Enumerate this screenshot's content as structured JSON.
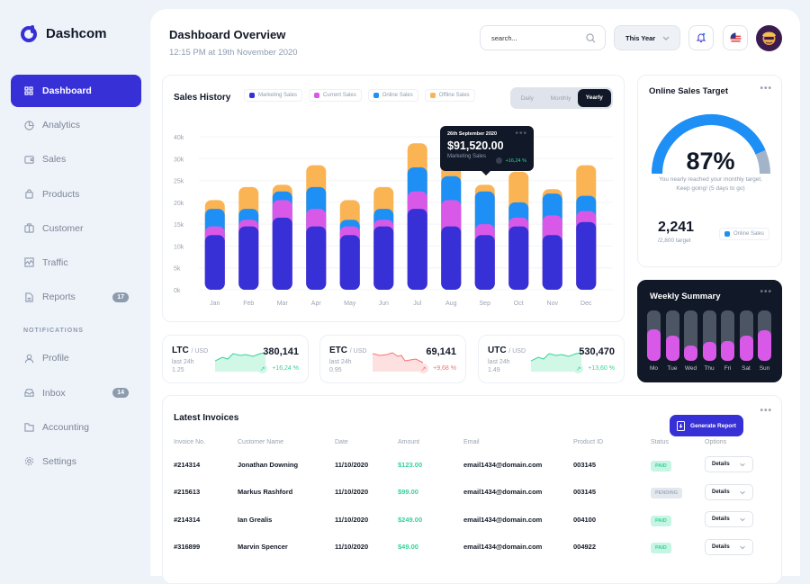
{
  "app": {
    "name": "Dashcom"
  },
  "sidebar": {
    "items": [
      {
        "label": "Dashboard",
        "icon": "grid-icon",
        "active": true
      },
      {
        "label": "Analytics",
        "icon": "pie-chart-icon"
      },
      {
        "label": "Sales",
        "icon": "wallet-icon"
      },
      {
        "label": "Products",
        "icon": "shopping-bag-icon"
      },
      {
        "label": "Customer",
        "icon": "briefcase-icon"
      },
      {
        "label": "Traffic",
        "icon": "activity-icon"
      },
      {
        "label": "Reports",
        "icon": "document-icon",
        "badge": "17"
      }
    ],
    "section_label": "NOTIFICATIONS",
    "notif_items": [
      {
        "label": "Profile",
        "icon": "user-icon"
      },
      {
        "label": "Inbox",
        "icon": "inbox-icon",
        "badge": "14"
      },
      {
        "label": "Accounting",
        "icon": "folder-icon"
      },
      {
        "label": "Settings",
        "icon": "gear-icon"
      }
    ]
  },
  "header": {
    "title": "Dashboard Overview",
    "subtitle": "12:15 PM at 19th November 2020",
    "search_placeholder": "search...",
    "period": "This Year"
  },
  "sales_history": {
    "title": "Sales History",
    "legend": [
      "Marketing Sales",
      "Current Sales",
      "Online Sales",
      "Offline Sales"
    ],
    "tabs": [
      "Daily",
      "Monthly",
      "Yearly"
    ],
    "active_tab": "Yearly",
    "tooltip": {
      "date": "26th September 2020",
      "value": "$91,520.00",
      "label": "Marketing Sales",
      "change": "+16,24 %"
    }
  },
  "chart_data": {
    "type": "bar",
    "stacked": true,
    "title": "Sales History",
    "categories": [
      "Jan",
      "Feb",
      "Mar",
      "Apr",
      "May",
      "Jun",
      "Jul",
      "Aug",
      "Sep",
      "Oct",
      "Nov",
      "Dec"
    ],
    "y_tick_labels": [
      "0k",
      "5k",
      "10k",
      "15k",
      "20k",
      "25k",
      "30k",
      "40k"
    ],
    "ylim": [
      0,
      35
    ],
    "ylabel_units": "k",
    "colors": {
      "Marketing Sales": "#3730d6",
      "Current Sales": "#d859e8",
      "Online Sales": "#1e90f5",
      "Offline Sales": "#fbb454"
    },
    "series": [
      {
        "name": "Marketing Sales",
        "values": [
          12.5,
          14.5,
          16.5,
          14.5,
          12.5,
          14.5,
          18.5,
          14.5,
          12.5,
          14.5,
          12.5,
          15.5
        ]
      },
      {
        "name": "Current Sales",
        "values": [
          2,
          1.5,
          4,
          4,
          2,
          1.5,
          4,
          6,
          2.5,
          2,
          4.5,
          2.5
        ]
      },
      {
        "name": "Online Sales",
        "values": [
          4,
          2.5,
          2,
          5,
          1.5,
          2.5,
          5.5,
          5.5,
          7.5,
          3.5,
          5,
          3.5
        ]
      },
      {
        "name": "Offline Sales",
        "values": [
          2,
          5,
          1.5,
          5,
          4.5,
          5,
          5.5,
          4,
          1.5,
          7,
          1,
          7
        ]
      }
    ],
    "legend": "top",
    "grid": true
  },
  "target": {
    "title": "Online Sales Target",
    "percent": 87,
    "percent_label": "87%",
    "message": "You nearly reached your monthly target. Keep going! (5 days to go)",
    "value": "2,241",
    "target": "/2,800 target",
    "legend": "Online Sales"
  },
  "weekly": {
    "title": "Weekly Summary",
    "days": [
      "Mo",
      "Tue",
      "Wed",
      "Thu",
      "Fri",
      "Sat",
      "Sun"
    ],
    "levels": [
      0.62,
      0.5,
      0.3,
      0.38,
      0.4,
      0.5,
      0.6
    ]
  },
  "coins": [
    {
      "symbol": "LTC",
      "pair": "/ USD",
      "label": "last 24h",
      "rate": "1.25",
      "value": "380,141",
      "change": "+16,24 %",
      "trend": "up",
      "color": "#34d399"
    },
    {
      "symbol": "ETC",
      "pair": "/ USD",
      "label": "last 24h",
      "rate": "0.95",
      "value": "69,141",
      "change": "+9,68 %",
      "trend": "down",
      "color": "#f87171"
    },
    {
      "symbol": "UTC",
      "pair": "/ USD",
      "label": "last 24h",
      "rate": "1.49",
      "value": "530,470",
      "change": "+13,60 %",
      "trend": "up",
      "color": "#34d399"
    }
  ],
  "invoices": {
    "title": "Latest Invoices",
    "generate_label": "Generate Report",
    "columns": [
      "Invoice No.",
      "Customer Name",
      "Date",
      "Amount",
      "Email",
      "Product ID",
      "Status",
      "Options"
    ],
    "rows": [
      {
        "id": "#214314",
        "name": "Jonathan Downing",
        "date": "11/10/2020",
        "amount": "$123.00",
        "email": "email1434@domain.com",
        "product": "003145",
        "status": "PAID",
        "option": "Details"
      },
      {
        "id": "#215613",
        "name": "Markus Rashford",
        "date": "11/10/2020",
        "amount": "$99.00",
        "email": "email1434@domain.com",
        "product": "003145",
        "status": "PENDING",
        "option": "Details"
      },
      {
        "id": "#214314",
        "name": "Ian Grealis",
        "date": "11/10/2020",
        "amount": "$249.00",
        "email": "email1434@domain.com",
        "product": "004100",
        "status": "PAID",
        "option": "Details"
      },
      {
        "id": "#316899",
        "name": "Marvin Spencer",
        "date": "11/10/2020",
        "amount": "$49.00",
        "email": "email1434@domain.com",
        "product": "004922",
        "status": "PAID",
        "option": "Details"
      }
    ]
  }
}
